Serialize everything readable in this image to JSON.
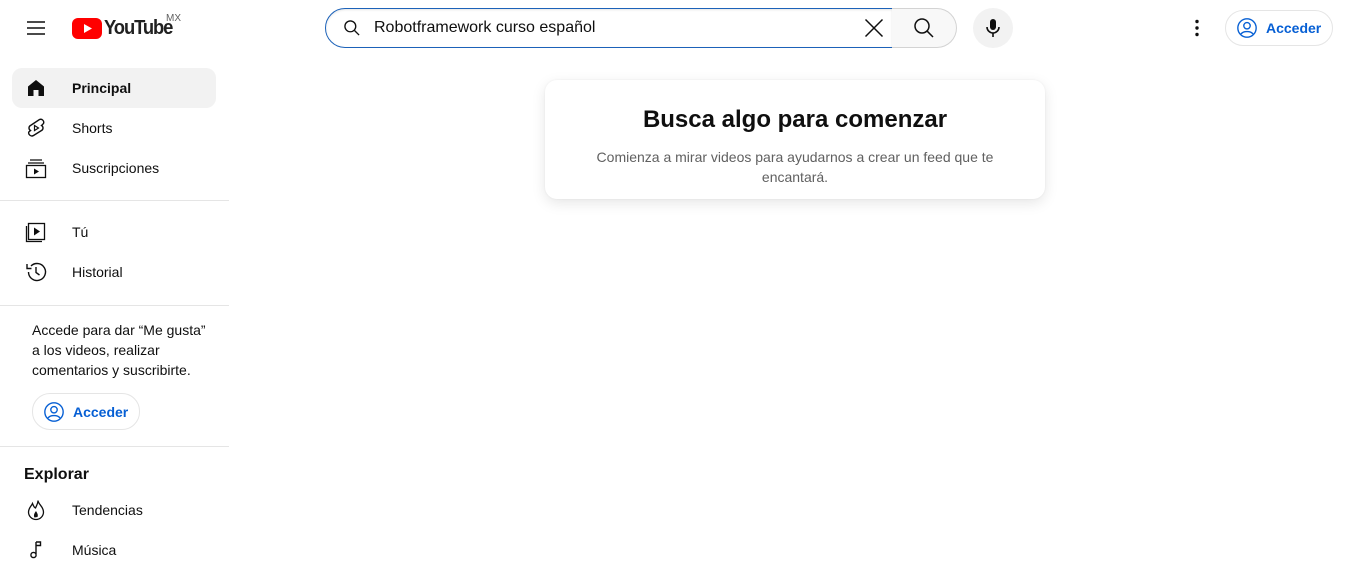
{
  "colors": {
    "accent": "#065fd4",
    "brand": "#ff0000",
    "active_bg": "#f2f2f2"
  },
  "header": {
    "logo_text": "YouTube",
    "country_code": "MX",
    "search": {
      "value": "Robotframework curso español"
    },
    "signin_label": "Acceder",
    "icons": [
      "menu-icon",
      "youtube-logo",
      "search-icon",
      "clear-icon",
      "mic-icon",
      "more-vertical-icon",
      "account-icon"
    ]
  },
  "sidebar": {
    "primary": [
      {
        "label": "Principal",
        "icon": "home-icon",
        "active": true
      },
      {
        "label": "Shorts",
        "icon": "shorts-icon",
        "active": false
      },
      {
        "label": "Suscripciones",
        "icon": "subscriptions-icon",
        "active": false
      }
    ],
    "you": [
      {
        "label": "Tú",
        "icon": "your-channel-icon"
      },
      {
        "label": "Historial",
        "icon": "history-icon"
      }
    ],
    "signin_prompt": "Accede para dar “Me gusta” a los videos, realizar comentarios y suscribirte.",
    "signin_label": "Acceder",
    "explore_title": "Explorar",
    "explore": [
      {
        "label": "Tendencias",
        "icon": "trending-icon"
      },
      {
        "label": "Música",
        "icon": "music-icon"
      }
    ]
  },
  "main": {
    "title": "Busca algo para comenzar",
    "body": "Comienza a mirar videos para ayudarnos a crear un feed que te encantará."
  }
}
